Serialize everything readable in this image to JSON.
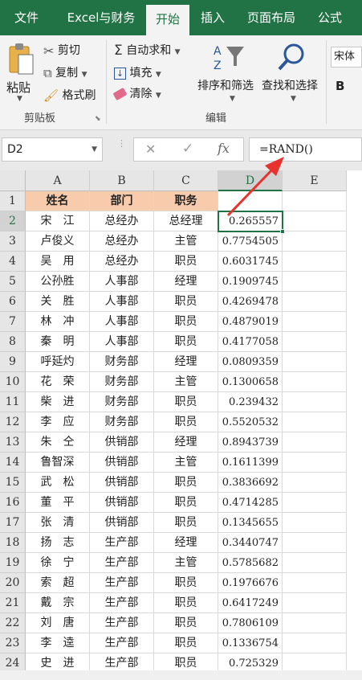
{
  "tabs": [
    {
      "label": "文件",
      "active": false
    },
    {
      "label": "Excel与财务",
      "active": false
    },
    {
      "label": "开始",
      "active": true
    },
    {
      "label": "插入",
      "active": false
    },
    {
      "label": "页面布局",
      "active": false
    },
    {
      "label": "公式",
      "active": false
    }
  ],
  "ribbon": {
    "clipboard": {
      "paste": "粘贴",
      "cut": "剪切",
      "copy": "复制",
      "format_painter": "格式刷",
      "group_label": "剪贴板"
    },
    "editing": {
      "autosum": "自动求和",
      "fill": "填充",
      "clear": "清除",
      "sort_filter": "排序和筛选",
      "find_select": "查找和选择",
      "group_label": "编辑"
    },
    "font": {
      "font_name": "宋体",
      "bold": "B"
    }
  },
  "formula_bar": {
    "name_box": "D2",
    "cancel": "✕",
    "enter": "✓",
    "fx": "fx",
    "formula": "=RAND()"
  },
  "columns": [
    "A",
    "B",
    "C",
    "D",
    "E"
  ],
  "selected_column": "D",
  "selected_row": 2,
  "accent_color": "#217346",
  "header_fill": "#f8cbad",
  "arrow_color": "#e8322d",
  "header_row": [
    "姓名",
    "部门",
    "职务"
  ],
  "rows": [
    {
      "row": 2,
      "name": "宋　江",
      "dept": "总经办",
      "title": "总经理",
      "value": "0.265557"
    },
    {
      "row": 3,
      "name": "卢俊义",
      "dept": "总经办",
      "title": "主管",
      "value": "0.7754505"
    },
    {
      "row": 4,
      "name": "吴　用",
      "dept": "总经办",
      "title": "职员",
      "value": "0.6031745"
    },
    {
      "row": 5,
      "name": "公孙胜",
      "dept": "人事部",
      "title": "经理",
      "value": "0.1909745"
    },
    {
      "row": 6,
      "name": "关　胜",
      "dept": "人事部",
      "title": "职员",
      "value": "0.4269478"
    },
    {
      "row": 7,
      "name": "林　冲",
      "dept": "人事部",
      "title": "职员",
      "value": "0.4879019"
    },
    {
      "row": 8,
      "name": "秦　明",
      "dept": "人事部",
      "title": "职员",
      "value": "0.4177058"
    },
    {
      "row": 9,
      "name": "呼延灼",
      "dept": "财务部",
      "title": "经理",
      "value": "0.0809359"
    },
    {
      "row": 10,
      "name": "花　荣",
      "dept": "财务部",
      "title": "主管",
      "value": "0.1300658"
    },
    {
      "row": 11,
      "name": "柴　进",
      "dept": "财务部",
      "title": "职员",
      "value": "0.239432"
    },
    {
      "row": 12,
      "name": "李　应",
      "dept": "财务部",
      "title": "职员",
      "value": "0.5520532"
    },
    {
      "row": 13,
      "name": "朱　仝",
      "dept": "供销部",
      "title": "经理",
      "value": "0.8943739"
    },
    {
      "row": 14,
      "name": "鲁智深",
      "dept": "供销部",
      "title": "主管",
      "value": "0.1611399"
    },
    {
      "row": 15,
      "name": "武　松",
      "dept": "供销部",
      "title": "职员",
      "value": "0.3836692"
    },
    {
      "row": 16,
      "name": "董　平",
      "dept": "供销部",
      "title": "职员",
      "value": "0.4714285"
    },
    {
      "row": 17,
      "name": "张　清",
      "dept": "供销部",
      "title": "职员",
      "value": "0.1345655"
    },
    {
      "row": 18,
      "name": "扬　志",
      "dept": "生产部",
      "title": "经理",
      "value": "0.3440747"
    },
    {
      "row": 19,
      "name": "徐　宁",
      "dept": "生产部",
      "title": "主管",
      "value": "0.5785682"
    },
    {
      "row": 20,
      "name": "索　超",
      "dept": "生产部",
      "title": "职员",
      "value": "0.1976676"
    },
    {
      "row": 21,
      "name": "戴　宗",
      "dept": "生产部",
      "title": "职员",
      "value": "0.6417249"
    },
    {
      "row": 22,
      "name": "刘　唐",
      "dept": "生产部",
      "title": "职员",
      "value": "0.7806109"
    },
    {
      "row": 23,
      "name": "李　逵",
      "dept": "生产部",
      "title": "职员",
      "value": "0.1336754"
    },
    {
      "row": 24,
      "name": "史　进",
      "dept": "生产部",
      "title": "职员",
      "value": "0.725329"
    }
  ]
}
